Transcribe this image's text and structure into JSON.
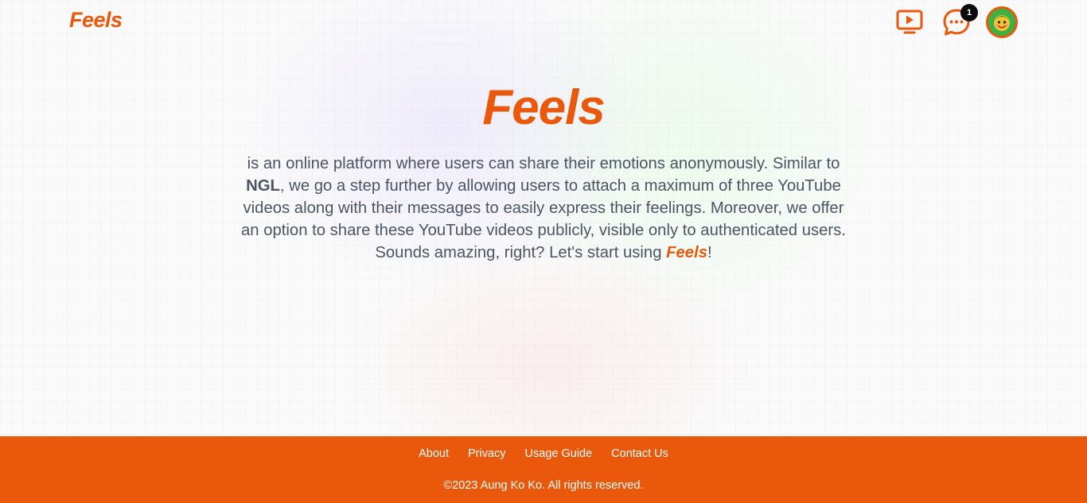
{
  "navbar": {
    "brand": "Feels",
    "icons": {
      "video": "play-screen-icon",
      "chat": "chat-bubble-icon",
      "avatar": "avatar"
    },
    "notification_count": "1"
  },
  "hero": {
    "title": "Feels",
    "text_part1": "is an online platform where users can share their emotions anonymously. Similar to ",
    "text_bold": "NGL",
    "text_part2": ", we go a step further by allowing users to attach a maximum of three YouTube videos along with their messages to easily express their feelings. Moreover, we offer an option to share these YouTube videos publicly, visible only to authenticated users. Sounds amazing, right? Let's start using ",
    "text_brand": "Feels",
    "text_end": "!"
  },
  "footer": {
    "links": [
      "About",
      "Privacy",
      "Usage Guide",
      "Contact Us"
    ],
    "copyright": "©2023 Aung Ko Ko. All rights reserved."
  },
  "colors": {
    "accent": "#ea580c",
    "text": "#4b5563",
    "badge": "#0b0b0b"
  }
}
